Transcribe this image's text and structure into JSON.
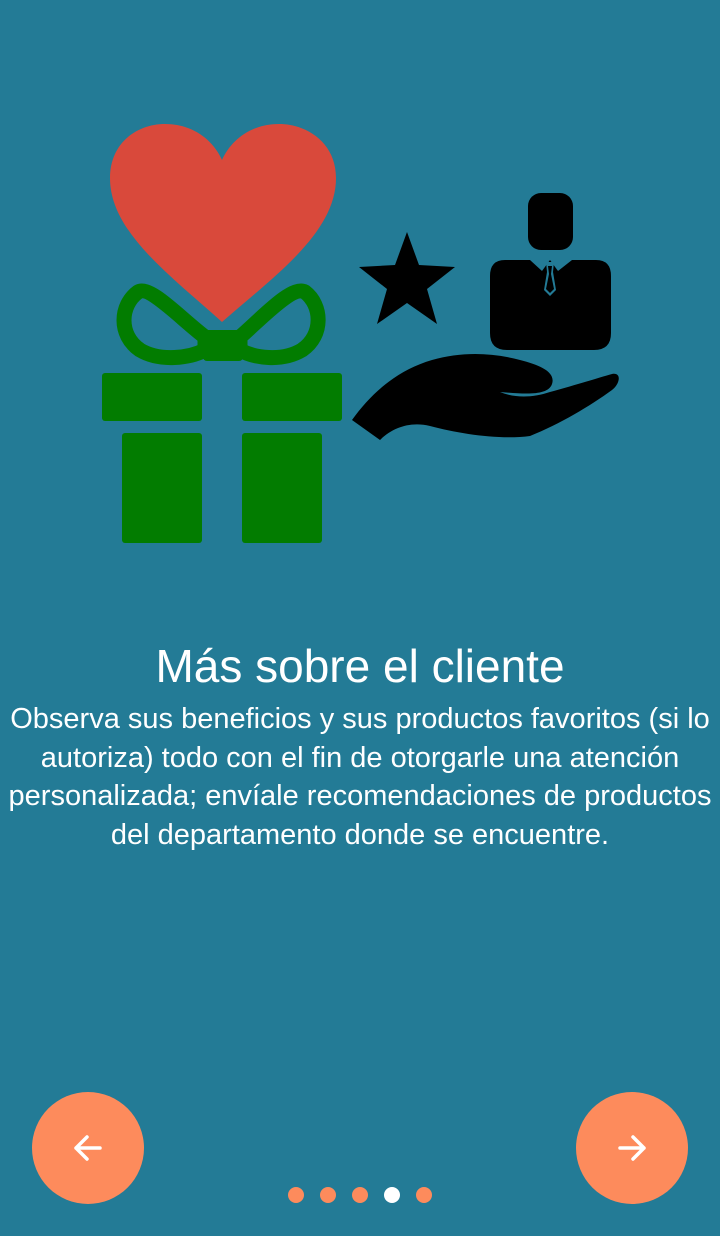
{
  "slide": {
    "title": "Más sobre el cliente",
    "description": "Observa sus beneficios y sus productos favoritos (si lo autoriza) todo con el fin de otorgarle una atención personalizada; envíale recomendaciones de productos del departamento donde se encuentre."
  },
  "illustration": {
    "icons": [
      "heart-icon",
      "gift-box-icon",
      "star-icon",
      "businessman-icon",
      "open-hand-icon"
    ],
    "colors": {
      "heart": "#d9493b",
      "gift": "#027c00",
      "icons_dark": "#000000"
    }
  },
  "navigation": {
    "prev_icon": "arrow-left-icon",
    "next_icon": "arrow-right-icon",
    "button_color": "#fd8b5c"
  },
  "pagination": {
    "total": 5,
    "current": 4,
    "dot_color": "#fd8b5c",
    "active_color": "#ffffff"
  },
  "background_color": "#237b96"
}
